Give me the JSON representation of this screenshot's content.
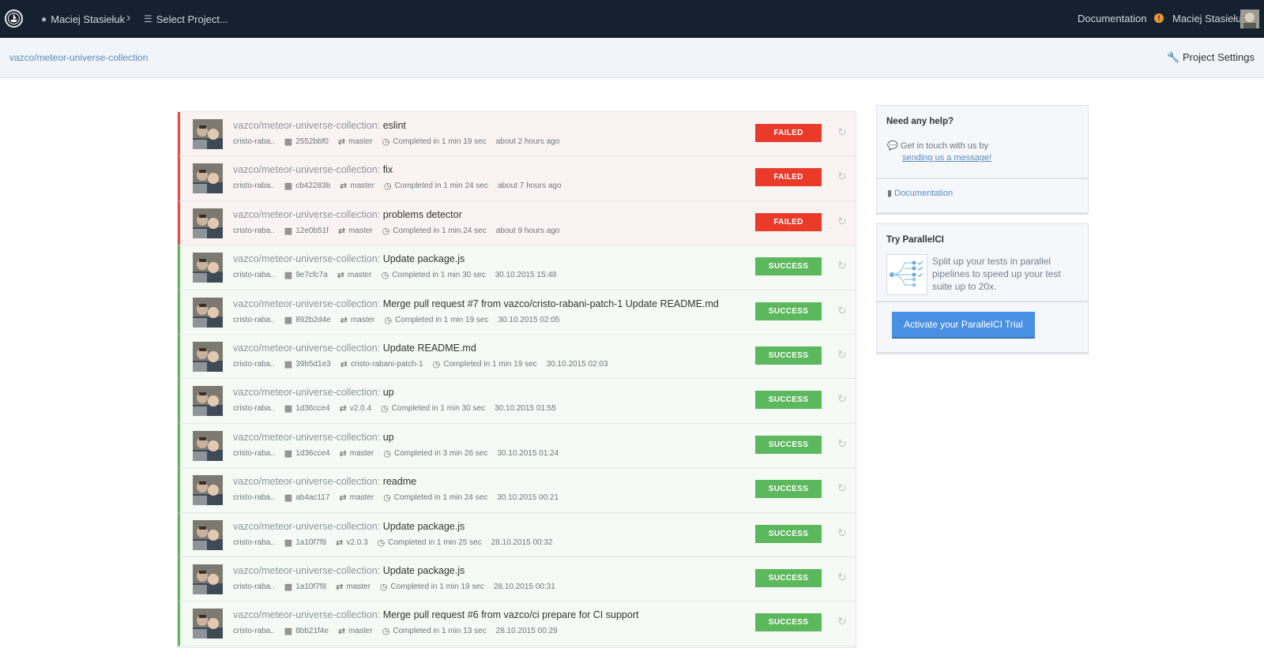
{
  "topbar": {
    "user": "Maciej Stasiełuk",
    "project_select": "Select Project...",
    "documentation": "Documentation",
    "account_name": "Maciej Stasiełuk",
    "alert": "!"
  },
  "subbar": {
    "breadcrumb": "vazco/meteor-universe-collection",
    "settings": "Project Settings"
  },
  "builds": [
    {
      "repo": "vazco/meteor-universe-collection:",
      "msg": "eslint",
      "author": "cristo-raba..",
      "sha": "2552bbf0",
      "branch": "master",
      "duration": "Completed in 1 min 19 sec",
      "time": "about 2 hours ago",
      "status": "FAILED",
      "status_type": "failed"
    },
    {
      "repo": "vazco/meteor-universe-collection:",
      "msg": "fix",
      "author": "cristo-raba..",
      "sha": "cb42283b",
      "branch": "master",
      "duration": "Completed in 1 min 24 sec",
      "time": "about 7 hours ago",
      "status": "FAILED",
      "status_type": "failed"
    },
    {
      "repo": "vazco/meteor-universe-collection:",
      "msg": "problems detector",
      "author": "cristo-raba..",
      "sha": "12e0b51f",
      "branch": "master",
      "duration": "Completed in 1 min 24 sec",
      "time": "about 9 hours ago",
      "status": "FAILED",
      "status_type": "failed"
    },
    {
      "repo": "vazco/meteor-universe-collection:",
      "msg": "Update package.js",
      "author": "cristo-raba..",
      "sha": "9e7cfc7a",
      "branch": "master",
      "duration": "Completed in 1 min 30 sec",
      "time": "30.10.2015 15:48",
      "status": "SUCCESS",
      "status_type": "success"
    },
    {
      "repo": "vazco/meteor-universe-collection:",
      "msg": "Merge pull request #7 from vazco/cristo-rabani-patch-1 Update README.md",
      "author": "cristo-raba..",
      "sha": "892b2d4e",
      "branch": "master",
      "duration": "Completed in 1 min 19 sec",
      "time": "30.10.2015 02:05",
      "status": "SUCCESS",
      "status_type": "success"
    },
    {
      "repo": "vazco/meteor-universe-collection:",
      "msg": "Update README.md",
      "author": "cristo-raba..",
      "sha": "39b5d1e3",
      "branch": "cristo-rabani-patch-1",
      "duration": "Completed in 1 min 19 sec",
      "time": "30.10.2015 02:03",
      "status": "SUCCESS",
      "status_type": "success"
    },
    {
      "repo": "vazco/meteor-universe-collection:",
      "msg": "up",
      "author": "cristo-raba..",
      "sha": "1d36cce4",
      "branch": "v2.0.4",
      "duration": "Completed in 1 min 30 sec",
      "time": "30.10.2015 01:55",
      "status": "SUCCESS",
      "status_type": "success"
    },
    {
      "repo": "vazco/meteor-universe-collection:",
      "msg": "up",
      "author": "cristo-raba..",
      "sha": "1d36cce4",
      "branch": "master",
      "duration": "Completed in 3 min 26 sec",
      "time": "30.10.2015 01:24",
      "status": "SUCCESS",
      "status_type": "success"
    },
    {
      "repo": "vazco/meteor-universe-collection:",
      "msg": "readme",
      "author": "cristo-raba..",
      "sha": "ab4ac117",
      "branch": "master",
      "duration": "Completed in 1 min 24 sec",
      "time": "30.10.2015 00:21",
      "status": "SUCCESS",
      "status_type": "success"
    },
    {
      "repo": "vazco/meteor-universe-collection:",
      "msg": "Update package.js",
      "author": "cristo-raba..",
      "sha": "1a10f7f8",
      "branch": "v2.0.3",
      "duration": "Completed in 1 min 25 sec",
      "time": "28.10.2015 00:32",
      "status": "SUCCESS",
      "status_type": "success"
    },
    {
      "repo": "vazco/meteor-universe-collection:",
      "msg": "Update package.js",
      "author": "cristo-raba..",
      "sha": "1a10f7f8",
      "branch": "master",
      "duration": "Completed in 1 min 19 sec",
      "time": "28.10.2015 00:31",
      "status": "SUCCESS",
      "status_type": "success"
    },
    {
      "repo": "vazco/meteor-universe-collection:",
      "msg": "Merge pull request #6 from vazco/ci prepare for CI support",
      "author": "cristo-raba..",
      "sha": "8bb21f4e",
      "branch": "master",
      "duration": "Completed in 1 min 13 sec",
      "time": "28.10.2015 00:29",
      "status": "SUCCESS",
      "status_type": "success"
    }
  ],
  "help": {
    "title": "Need any help?",
    "contact_text": "Get in touch with us by",
    "contact_link": "sending us a message!",
    "docs_link": "Documentation"
  },
  "parallelci": {
    "title": "Try ParallelCI",
    "description": "Split up your tests in parallel pipelines to speed up your test suite up to 20x.",
    "button": "Activate your ParallelCI Trial"
  },
  "colors": {
    "failed": "#ea3a2a",
    "success": "#5cb85c",
    "topbar": "#162130",
    "link": "#5b8cc0"
  }
}
